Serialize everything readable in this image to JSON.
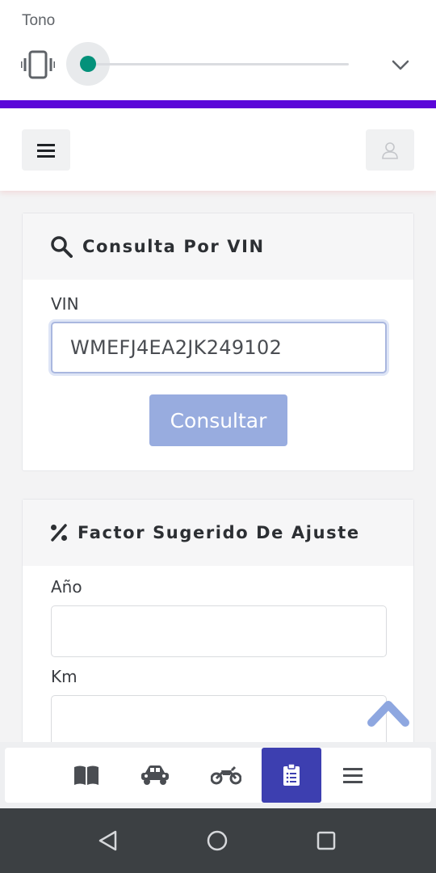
{
  "volume_panel": {
    "title": "Tono",
    "mode_icon": "vibrate-icon",
    "level": 0,
    "expand_icon": "chevron-down-icon",
    "thumb_color": "#03917a",
    "accent_bar_color": "#5b07d9"
  },
  "header": {
    "menu_icon": "hamburger-icon",
    "user_icon": "user-icon"
  },
  "vin_card": {
    "icon": "search-icon",
    "title": "Consulta Por VIN",
    "vin_label": "VIN",
    "vin_value": "WMEFJ4EA2JK249102",
    "submit_label": "Consultar"
  },
  "factor_card": {
    "icon": "percent-icon",
    "title": "Factor Sugerido De Ajuste",
    "year_label": "Año",
    "year_value": "",
    "km_label": "Km",
    "km_value": ""
  },
  "scroll_top_icon": "chevron-up-icon",
  "bottom_nav": {
    "items": [
      {
        "icon": "book-icon",
        "active": false
      },
      {
        "icon": "car-icon",
        "active": false
      },
      {
        "icon": "motorcycle-icon",
        "active": false
      },
      {
        "icon": "clipboard-list-icon",
        "active": true
      },
      {
        "icon": "menu-icon",
        "active": false
      }
    ],
    "active_color": "#3d3fb0"
  },
  "system_nav": {
    "back_icon": "back-triangle-icon",
    "home_icon": "home-circle-icon",
    "recents_icon": "recents-square-icon"
  }
}
